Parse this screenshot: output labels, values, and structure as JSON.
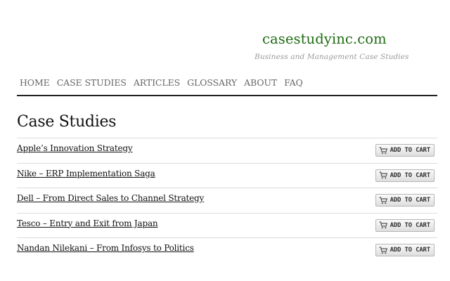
{
  "site": {
    "title": "casestudyinc.com",
    "tagline": "Business and Management Case Studies",
    "title_color": "#1e6a12"
  },
  "nav": {
    "items": [
      {
        "label": "HOME"
      },
      {
        "label": "CASE STUDIES"
      },
      {
        "label": "ARTICLES"
      },
      {
        "label": "GLOSSARY"
      },
      {
        "label": "ABOUT"
      },
      {
        "label": "FAQ"
      }
    ]
  },
  "page": {
    "title": "Case Studies"
  },
  "case_studies": [
    {
      "title": "Apple’s Innovation Strategy",
      "cart_label": "ADD TO CART",
      "cart_icon": "shopping-cart-icon"
    },
    {
      "title": "Nike – ERP Implementation Saga",
      "cart_label": "ADD TO CART",
      "cart_icon": "shopping-cart-icon"
    },
    {
      "title": "Dell – From Direct Sales to Channel Strategy",
      "cart_label": "ADD TO CART",
      "cart_icon": "shopping-cart-icon"
    },
    {
      "title": "Tesco – Entry and Exit from Japan",
      "cart_label": "ADD TO CART",
      "cart_icon": "shopping-cart-icon"
    },
    {
      "title": "Nandan Nilekani – From Infosys to Politics",
      "cart_label": "ADD TO CART",
      "cart_icon": "shopping-cart-icon"
    }
  ]
}
